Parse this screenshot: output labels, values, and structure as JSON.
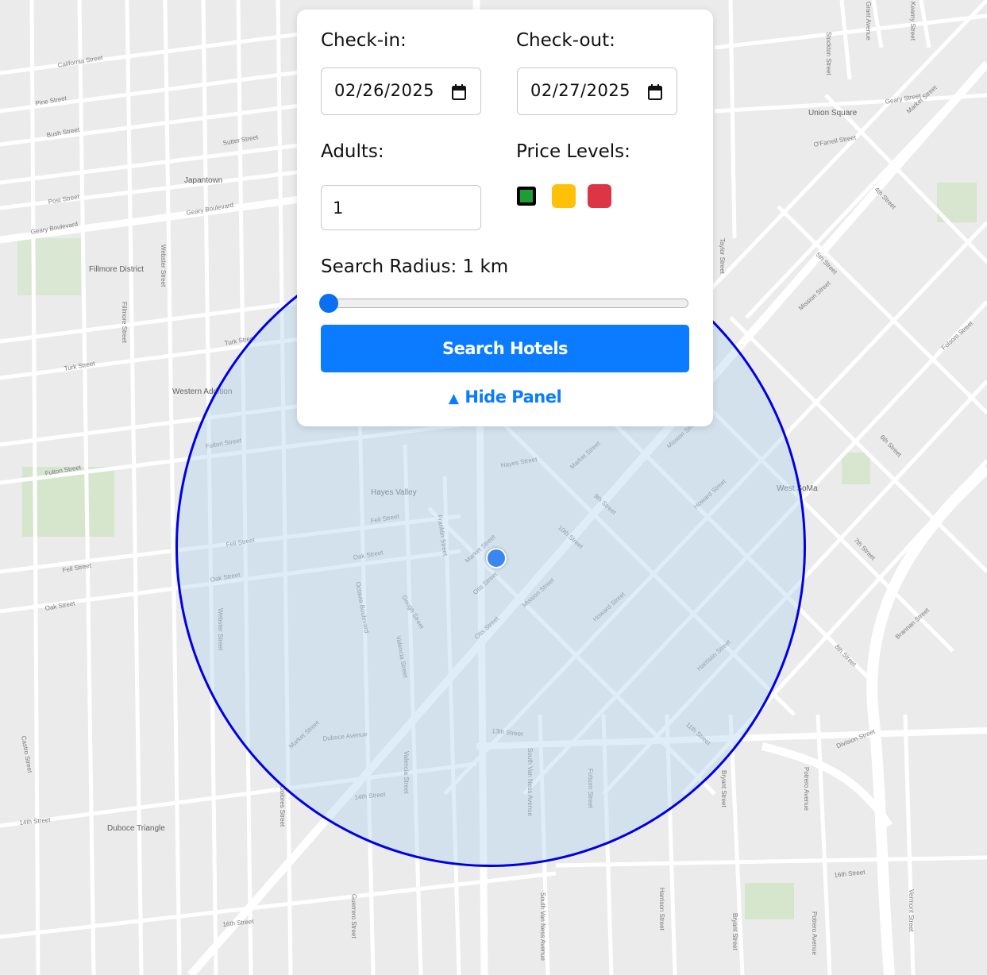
{
  "map": {
    "neighborhood_labels": [
      "Japantown",
      "Fillmore District",
      "Western Addition",
      "Hayes Valley",
      "Union Square",
      "West SoMa",
      "Duboce Triangle"
    ],
    "street_labels": [
      "California Street",
      "Pine Street",
      "Bush Street",
      "Sutter Street",
      "Post Street",
      "Geary Boulevard",
      "Geary Boulevard",
      "Turk Street",
      "Turk Street",
      "Fulton Street",
      "Fulton Street",
      "Fell Street",
      "Fell Street",
      "Fell Street",
      "Oak Street",
      "Oak Street",
      "Oak Street",
      "Hayes Street",
      "Market Street",
      "Market Street",
      "Market Street",
      "Mission Street",
      "Mission Street",
      "Howard Street",
      "Howard Street",
      "Folsom Street",
      "9th Street",
      "10th Street",
      "11th Street",
      "13th Street",
      "14th Street",
      "14th Street",
      "16th Street",
      "16th Street",
      "Duboce Avenue",
      "Franklin Street",
      "Gough Street",
      "Octavia Boulevard",
      "Valencia Street",
      "Valencia Street",
      "South Van Ness Avenue",
      "South Van Ness Avenue",
      "Folsom Street",
      "Bryant Street",
      "Bryant Street",
      "Potrero Avenue",
      "Potrero Avenue",
      "Division Street",
      "Harrison Street",
      "Harrison Street",
      "Webster Street",
      "Webster Street",
      "Fillmore Street",
      "Castro Street",
      "Dolores Street",
      "Guerrero Street",
      "Taylor Street",
      "Stockton Street",
      "Grant Avenue",
      "Kearny Street",
      "Geary Street",
      "O'Farrell Street",
      "Market Street",
      "4th Street",
      "5th Street",
      "6th Street",
      "7th Street",
      "8th Street",
      "Mission Street",
      "Brannan Street",
      "Vermont Street",
      "Otis Street",
      "Otis Street"
    ]
  },
  "panel": {
    "checkin": {
      "label": "Check-in:",
      "value": "02/26/2025"
    },
    "checkout": {
      "label": "Check-out:",
      "value": "02/27/2025"
    },
    "adults": {
      "label": "Adults:",
      "value": "1"
    },
    "price_levels": {
      "label": "Price Levels:",
      "swatches": [
        {
          "name": "green",
          "color": "#1f9d35",
          "selected": true
        },
        {
          "name": "yellow",
          "color": "#ffc107",
          "selected": false
        },
        {
          "name": "red",
          "color": "#dc3545",
          "selected": false
        }
      ]
    },
    "radius": {
      "label": "Search Radius: 1 km",
      "value_km": 1,
      "min_km": 1,
      "max_km": 20
    },
    "search_button": "Search Hotels",
    "hide_panel": "Hide Panel"
  },
  "colors": {
    "primary": "#0b7bff",
    "radius_stroke": "#0000e6",
    "radius_fill": "#b2d3f0",
    "marker": "#3b86f0"
  }
}
